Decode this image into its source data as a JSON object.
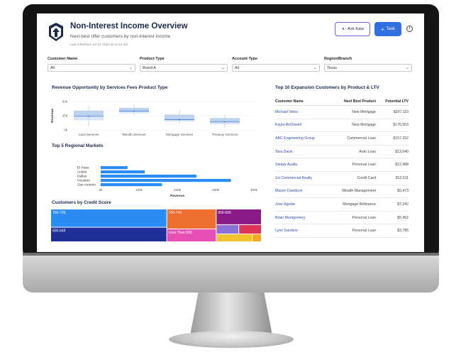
{
  "header": {
    "title": "Non-Interest Income Overview",
    "subtitle": "Next best offer customers by non-interest income",
    "last_refreshed": "Last refreshed: Jul 12, 2024 at 12:14 AM",
    "ask_button": "Ask Kaia",
    "task_button": "Task",
    "accent_color": "#2f6fe0"
  },
  "filters": [
    {
      "label": "Customer Name",
      "value": "All"
    },
    {
      "label": "Product Type",
      "value": "Brand A"
    },
    {
      "label": "Account Type",
      "value": "All"
    },
    {
      "label": "Region/Branch",
      "value": "Texas"
    }
  ],
  "revenue_chart": {
    "title": "Revenue Opportunity by Services Fees Product Type",
    "ylabel": "Revenue",
    "yticks": [
      "50k",
      "25k",
      "0k"
    ],
    "categories": [
      "Card Services",
      "Wealth Services",
      "Mortgage Services",
      "Treasury Services"
    ]
  },
  "markets_chart": {
    "title": "Top 5 Regional Markets",
    "xlabel": "Revenue",
    "xticks": [
      "0k",
      "100k",
      "200k",
      "300k",
      "400k"
    ]
  },
  "credit_chart": {
    "title": "Customers by Credit Score"
  },
  "chart_data": [
    {
      "type": "box",
      "title": "Revenue Opportunity by Services Fees Product Type",
      "ylabel": "Revenue",
      "ylim": [
        0,
        50000
      ],
      "categories": [
        "Card Services",
        "Wealth Services",
        "Mortgage Services",
        "Treasury Services"
      ],
      "boxes": [
        {
          "min": 6000,
          "q1": 17000,
          "median": 24000,
          "q3": 34000,
          "max": 42000
        },
        {
          "min": 26000,
          "q1": 29000,
          "median": 33000,
          "q3": 39000,
          "max": 44000
        },
        {
          "min": 11000,
          "q1": 15000,
          "median": 18000,
          "q3": 27000,
          "max": 34000
        },
        {
          "min": 3000,
          "q1": 10000,
          "median": 14000,
          "q3": 21000,
          "max": 25000
        }
      ]
    },
    {
      "type": "bar",
      "orientation": "horizontal",
      "title": "Top 5 Regional Markets",
      "xlabel": "Revenue",
      "xlim": [
        0,
        400000
      ],
      "categories": [
        "El Paso",
        "Austin",
        "Dallas",
        "Houston",
        "San Antonio"
      ],
      "values": [
        70000,
        115000,
        250000,
        340000,
        160000
      ]
    },
    {
      "type": "treemap",
      "title": "Customers by Credit Score",
      "items": [
        {
          "label": "750-799",
          "value": 30,
          "color": "#2a8cf5"
        },
        {
          "label": "600-649",
          "value": 24,
          "color": "#1f2f9a"
        },
        {
          "label": "700-749",
          "value": 14,
          "color": "#ee6e30"
        },
        {
          "label": "Less Than 600",
          "value": 9,
          "color": "#e84fb4"
        },
        {
          "label": "650-699",
          "value": 10,
          "color": "#8a1a8a"
        },
        {
          "label": "",
          "value": 3,
          "color": "#8a6fd6"
        },
        {
          "label": "",
          "value": 3,
          "color": "#e03358"
        },
        {
          "label": "",
          "value": 4,
          "color": "#f0c22c"
        },
        {
          "label": "",
          "value": 1,
          "color": "#f5a623"
        }
      ]
    }
  ],
  "table": {
    "title": "Top 10 Expansion Customers by Product & LTV",
    "columns": [
      "Customer Name",
      "Next Best Product",
      "Potential LTV"
    ],
    "rows": [
      [
        "Michael Velez",
        "New Mortgage",
        "$207,110"
      ],
      [
        "Kayla McDowell",
        "New Mortgage",
        "$176,553"
      ],
      [
        "ABC Engineering Group",
        "Commercial Loan",
        "$157,252"
      ],
      [
        "Tara Davis",
        "Auto Loan",
        "$13,040"
      ],
      [
        "Sanjay Ayalla",
        "Personal Loan",
        "$12,988"
      ],
      [
        "1st Commercial Realty",
        "Credit Card",
        "$12,511"
      ],
      [
        "Mason Davidson",
        "Wealth Management",
        "$9,473"
      ],
      [
        "Jose Aguilar",
        "Mortgage Refinance",
        "$7,342"
      ],
      [
        "Brian Montgomery",
        "Personal Loan",
        "$5,452"
      ],
      [
        "Lynn Sanders",
        "Personal Loan",
        "$3,785"
      ]
    ]
  }
}
